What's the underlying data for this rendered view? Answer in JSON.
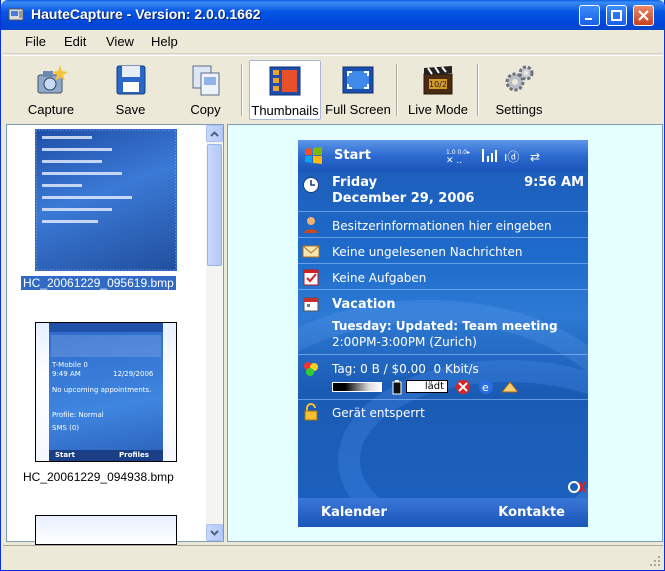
{
  "window": {
    "title": "HauteCapture - Version: 2.0.0.1662"
  },
  "menu": [
    "File",
    "Edit",
    "View",
    "Help"
  ],
  "toolbar": {
    "capture": "Capture",
    "save": "Save",
    "copy": "Copy",
    "thumbnails": "Thumbnails",
    "fullscreen": "Full Screen",
    "livemode": "Live Mode",
    "settings": "Settings"
  },
  "thumbnails": [
    {
      "filename": "HC_20061229_095619.bmp",
      "selected": true
    },
    {
      "filename": "HC_20061229_094938.bmp",
      "selected": false
    }
  ],
  "thumb2": {
    "carrier": "T-Mobile 0",
    "time": "9:49 AM",
    "date": "12/29/2006",
    "appt": "No upcoming appointments.",
    "profile": "Profile: Normal",
    "sms": "SMS (0)",
    "start": "Start",
    "profiles": "Profiles"
  },
  "preview": {
    "start": "Start",
    "day": "Friday",
    "date": "December 29, 2006",
    "time": "9:56 AM",
    "owner": "Besitzerinformationen hier eingeben",
    "messages": "Keine ungelesenen Nachrichten",
    "tasks": "Keine Aufgaben",
    "vacation": "Vacation",
    "meeting": "Tuesday: Updated: Team meeting",
    "meeting_time": "2:00PM-3:00PM (Zurich)",
    "traffic": "Tag: 0 B / $0.00  0 Kbit/s",
    "charging": "lädt",
    "locked": "Gerät entsperrt",
    "left_soft": "Kalender",
    "right_soft": "Kontakte"
  },
  "colors": {
    "titlebar": "#0554e3",
    "selection": "#316ac5",
    "preview_bg": "#e5feff"
  }
}
